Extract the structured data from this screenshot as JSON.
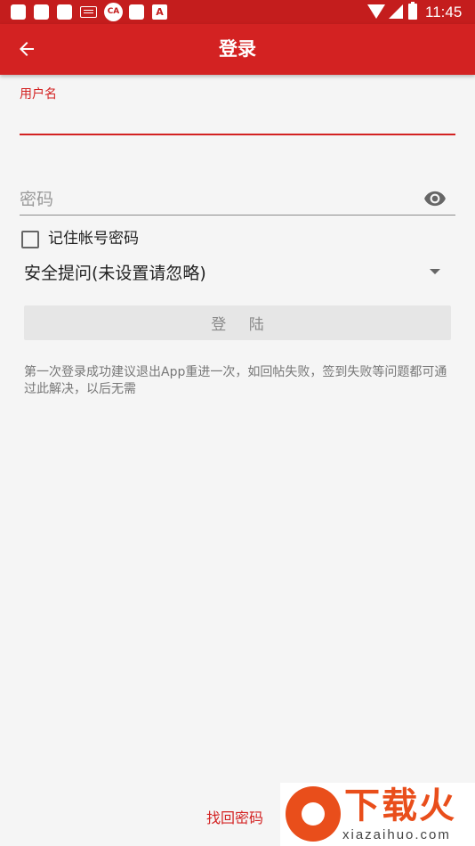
{
  "status_bar": {
    "time": "11:45",
    "icons": [
      "notification-icon",
      "notification-icon",
      "notification-icon",
      "keyboard-icon",
      "cloud-app-icon",
      "notification-icon",
      "a-app-icon",
      "wifi-icon",
      "signal-icon",
      "battery-icon"
    ]
  },
  "toolbar": {
    "title": "登录",
    "back_icon": "arrow-left-icon"
  },
  "form": {
    "username_label": "用户名",
    "username_value": "",
    "password_placeholder": "密码",
    "password_value": "",
    "remember_label": "记住帐号密码",
    "remember_checked": false,
    "security_question_value": "安全提问(未设置请忽略)",
    "login_button": "登 陆",
    "hint": "第一次登录成功建议退出App重进一次，如回帖失败，签到失败等问题都可通过此解决，以后无需"
  },
  "footer": {
    "forgot_password": "找回密码"
  },
  "watermark": {
    "brand": "下载火",
    "site": "xiazaihuo.com"
  },
  "colors": {
    "primary": "#d32222",
    "status_bar": "#c41d1d",
    "background": "#f5f5f5",
    "watermark": "#e94e1b"
  }
}
